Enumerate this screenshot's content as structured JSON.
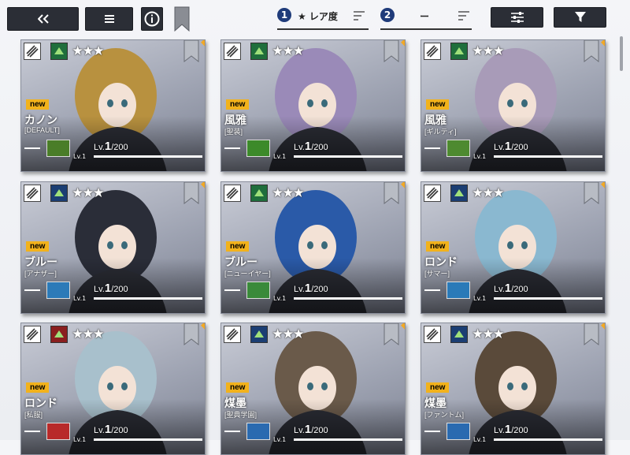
{
  "toolbar": {
    "back_icon": "double-chevron-left-icon",
    "menu_icon": "hamburger-icon",
    "info_icon": "info-icon",
    "bookmark_icon": "bookmark-icon",
    "filter_settings_icon": "sliders-icon",
    "filter_icon": "funnel-icon"
  },
  "sort": [
    {
      "index": "1",
      "label": "★ レア度",
      "order_icon": "sort-desc-lines-icon"
    },
    {
      "index": "2",
      "label": "ー",
      "order_icon": "sort-desc-lines-icon"
    }
  ],
  "colors": {
    "accent": "#1f3b7a",
    "new_badge": "#f2b21c",
    "dark_button": "#2b2e36",
    "favorite_dot": "#f2a824"
  },
  "cards": [
    {
      "name": "カノン",
      "sub": "[DEFAULT]",
      "new": "new",
      "stars": "★★★",
      "lv_prefix": "Lv.",
      "lv": "1",
      "lv_max": "/200",
      "lv_small": "Lv.1",
      "elem_icon": "sword-icon",
      "attr_icon": "house-icon",
      "attr_color": "#1f6e3c",
      "weapon_color": "#4a7d28",
      "art_tint": "#b8913f"
    },
    {
      "name": "風雅",
      "sub": "[聖装]",
      "new": "new",
      "stars": "★★★",
      "lv_prefix": "Lv.",
      "lv": "1",
      "lv_max": "/200",
      "lv_small": "Lv.1",
      "elem_icon": "chevrons-icon",
      "attr_icon": "house-icon",
      "attr_color": "#1f6e3c",
      "weapon_color": "#3c8a2a",
      "art_tint": "#9a8ab8"
    },
    {
      "name": "風雅",
      "sub": "[ギルティ]",
      "new": "new",
      "stars": "★★★",
      "lv_prefix": "Lv.",
      "lv": "1",
      "lv_max": "/200",
      "lv_small": "Lv.1",
      "elem_icon": "bow-icon",
      "attr_icon": "house-icon",
      "attr_color": "#1f6e3c",
      "weapon_color": "#4e8a30",
      "art_tint": "#a89bb8"
    },
    {
      "name": "ブルー",
      "sub": "[アナザー]",
      "new": "new",
      "stars": "★★★",
      "lv_prefix": "Lv.",
      "lv": "1",
      "lv_max": "/200",
      "lv_small": "Lv.1",
      "elem_icon": "sword-icon",
      "attr_icon": "x-cross-icon",
      "attr_color": "#1b3e73",
      "weapon_color": "#2c7ab8",
      "art_tint": "#2a2d38"
    },
    {
      "name": "ブルー",
      "sub": "[ニューイヤー]",
      "new": "new",
      "stars": "★★★",
      "lv_prefix": "Lv.",
      "lv": "1",
      "lv_max": "/200",
      "lv_small": "Lv.1",
      "elem_icon": "diamond-chain-icon",
      "attr_icon": "house-icon",
      "attr_color": "#1f6e3c",
      "weapon_color": "#3a8a3a",
      "art_tint": "#2a5aa8"
    },
    {
      "name": "ロンド",
      "sub": "[サマー]",
      "new": "new",
      "stars": "★★★",
      "lv_prefix": "Lv.",
      "lv": "1",
      "lv_max": "/200",
      "lv_small": "Lv.1",
      "elem_icon": "fist-icon",
      "attr_icon": "x-cross-icon",
      "attr_color": "#1b3e73",
      "weapon_color": "#2a7ab8",
      "art_tint": "#8ab8d0"
    },
    {
      "name": "ロンド",
      "sub": "[私服]",
      "new": "new",
      "stars": "★★★",
      "lv_prefix": "Lv.",
      "lv": "1",
      "lv_max": "/200",
      "lv_small": "Lv.1",
      "elem_icon": "sword-icon",
      "attr_icon": "spiral-icon",
      "attr_color": "#8a1f1f",
      "weapon_color": "#b82a2a",
      "art_tint": "#a8c0cc"
    },
    {
      "name": "煤墨",
      "sub": "[聖典学園]",
      "new": "new",
      "stars": "★★★",
      "lv_prefix": "Lv.",
      "lv": "1",
      "lv_max": "/200",
      "lv_small": "Lv.1",
      "elem_icon": "sword-icon",
      "attr_icon": "x-cross-icon",
      "attr_color": "#1b3e73",
      "weapon_color": "#2a6ab0",
      "art_tint": "#6a5a4a"
    },
    {
      "name": "煤墨",
      "sub": "[ファントム]",
      "new": "new",
      "stars": "★★★",
      "lv_prefix": "Lv.",
      "lv": "1",
      "lv_max": "/200",
      "lv_small": "Lv.1",
      "elem_icon": "diamond-chain-icon",
      "attr_icon": "x-cross-icon",
      "attr_color": "#1b3e73",
      "weapon_color": "#2a6ab0",
      "art_tint": "#5a4a3a"
    }
  ]
}
